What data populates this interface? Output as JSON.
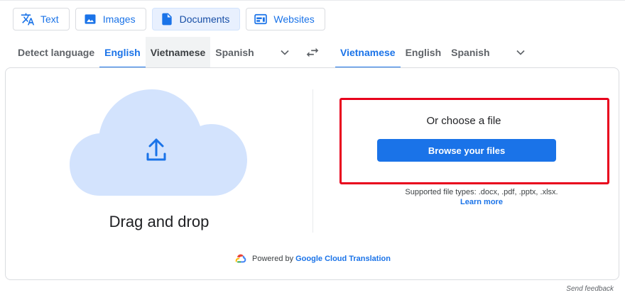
{
  "modes": [
    {
      "label": "Text",
      "icon": "translate-icon"
    },
    {
      "label": "Images",
      "icon": "image-icon"
    },
    {
      "label": "Documents",
      "icon": "document-icon"
    },
    {
      "label": "Websites",
      "icon": "website-icon"
    }
  ],
  "source_langs": [
    "Detect language",
    "English",
    "Vietnamese",
    "Spanish"
  ],
  "target_langs": [
    "Vietnamese",
    "English",
    "Spanish"
  ],
  "upload": {
    "drag_drop": "Drag and drop",
    "choose_file": "Or choose a file",
    "browse_button": "Browse your files",
    "supported": "Supported file types: .docx, .pdf, .pptx, .xlsx.",
    "learn_more": "Learn more"
  },
  "powered": {
    "prefix": "Powered by",
    "link": "Google Cloud Translation"
  },
  "feedback": "Send feedback",
  "colors": {
    "accent": "#1a73e8",
    "highlight": "#e8001c",
    "cloud": "#d3e3fd"
  }
}
